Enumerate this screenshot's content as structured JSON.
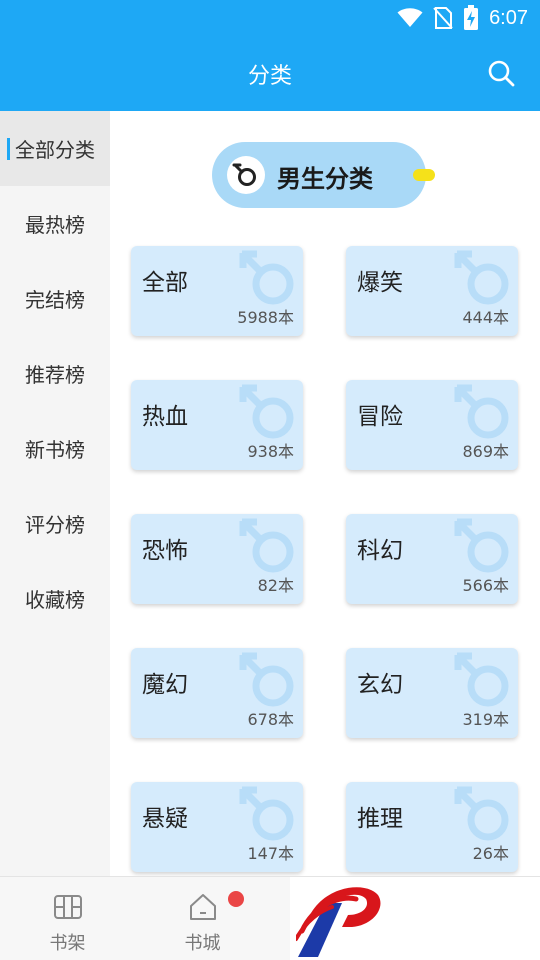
{
  "status_bar": {
    "time": "6:07",
    "icons": [
      "wifi-icon",
      "no-sim-icon",
      "battery-charging-icon"
    ]
  },
  "header": {
    "title": "分类",
    "search_icon": "search-icon"
  },
  "sidebar": {
    "items": [
      {
        "label": "全部分类",
        "active": true
      },
      {
        "label": "最热榜"
      },
      {
        "label": "完结榜"
      },
      {
        "label": "推荐榜"
      },
      {
        "label": "新书榜"
      },
      {
        "label": "评分榜"
      },
      {
        "label": "收藏榜"
      }
    ]
  },
  "gender_selector": {
    "label": "男生分类",
    "icon": "male-symbol-icon"
  },
  "categories": [
    {
      "name": "全部",
      "count": "5988本"
    },
    {
      "name": "爆笑",
      "count": "444本"
    },
    {
      "name": "热血",
      "count": "938本"
    },
    {
      "name": "冒险",
      "count": "869本"
    },
    {
      "name": "恐怖",
      "count": "82本"
    },
    {
      "name": "科幻",
      "count": "566本"
    },
    {
      "name": "魔幻",
      "count": "678本"
    },
    {
      "name": "玄幻",
      "count": "319本"
    },
    {
      "name": "悬疑",
      "count": "147本"
    },
    {
      "name": "推理",
      "count": "26本"
    }
  ],
  "bottom_nav": {
    "items": [
      {
        "label": "书架",
        "icon": "bookshelf-icon"
      },
      {
        "label": "书城",
        "icon": "home-icon",
        "badge": "red-dot"
      }
    ]
  },
  "colors": {
    "primary": "#1ea8f5",
    "card": "#d5ebfc",
    "pill": "#a9d9f7",
    "badge": "#ea4646"
  }
}
